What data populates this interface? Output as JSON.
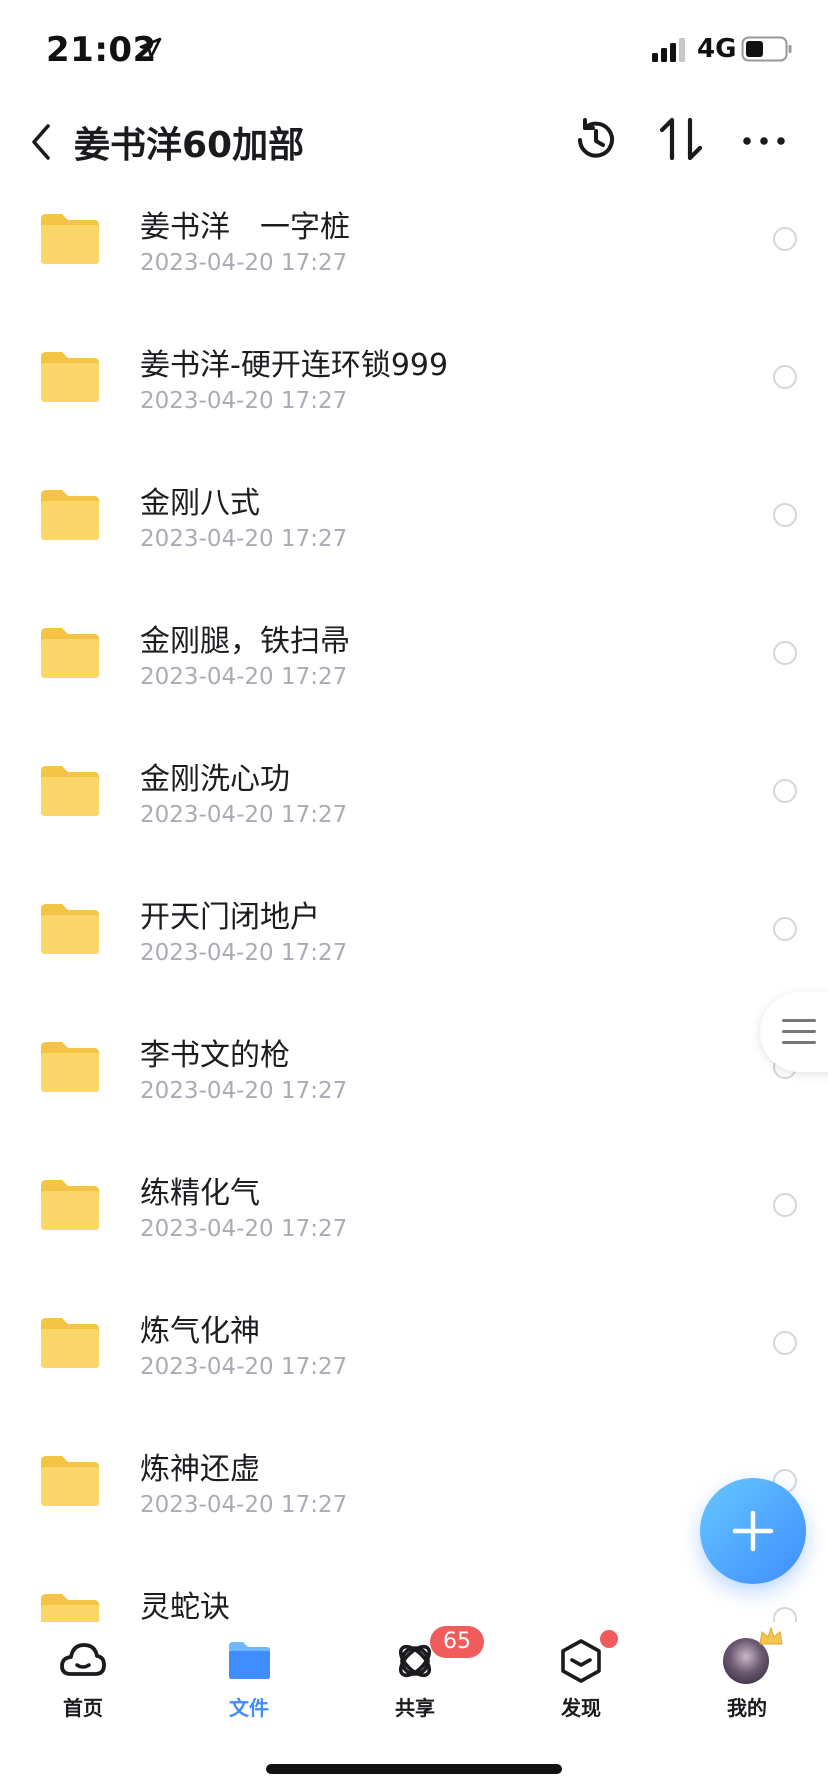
{
  "status_bar": {
    "time": "21:02",
    "network": "4G"
  },
  "nav": {
    "title": "姜书洋60加部"
  },
  "files": [
    {
      "name": "姜书洋　一字桩",
      "date": "2023-04-20 17:27"
    },
    {
      "name": "姜书洋-硬开连环锁999",
      "date": "2023-04-20 17:27"
    },
    {
      "name": "金刚八式",
      "date": "2023-04-20 17:27"
    },
    {
      "name": "金刚腿，铁扫帚",
      "date": "2023-04-20 17:27"
    },
    {
      "name": "金刚洗心功",
      "date": "2023-04-20 17:27"
    },
    {
      "name": "开天门闭地户",
      "date": "2023-04-20 17:27"
    },
    {
      "name": "李书文的枪",
      "date": "2023-04-20 17:27"
    },
    {
      "name": "练精化气",
      "date": "2023-04-20 17:27"
    },
    {
      "name": "炼气化神",
      "date": "2023-04-20 17:27"
    },
    {
      "name": "炼神还虚",
      "date": "2023-04-20 17:27"
    },
    {
      "name": "灵蛇诀",
      "date": ""
    }
  ],
  "tabs": [
    {
      "label": "首页",
      "icon": "cloud-home-icon",
      "active": false
    },
    {
      "label": "文件",
      "icon": "folder-icon",
      "active": true
    },
    {
      "label": "共享",
      "icon": "share-orbit-icon",
      "active": false,
      "badge": "65"
    },
    {
      "label": "发现",
      "icon": "discover-box-icon",
      "active": false,
      "dot": true
    },
    {
      "label": "我的",
      "icon": "avatar",
      "active": false
    }
  ],
  "colors": {
    "accent": "#3f8dff",
    "folder": "#f7cf5a",
    "badge": "#f05c5c"
  }
}
